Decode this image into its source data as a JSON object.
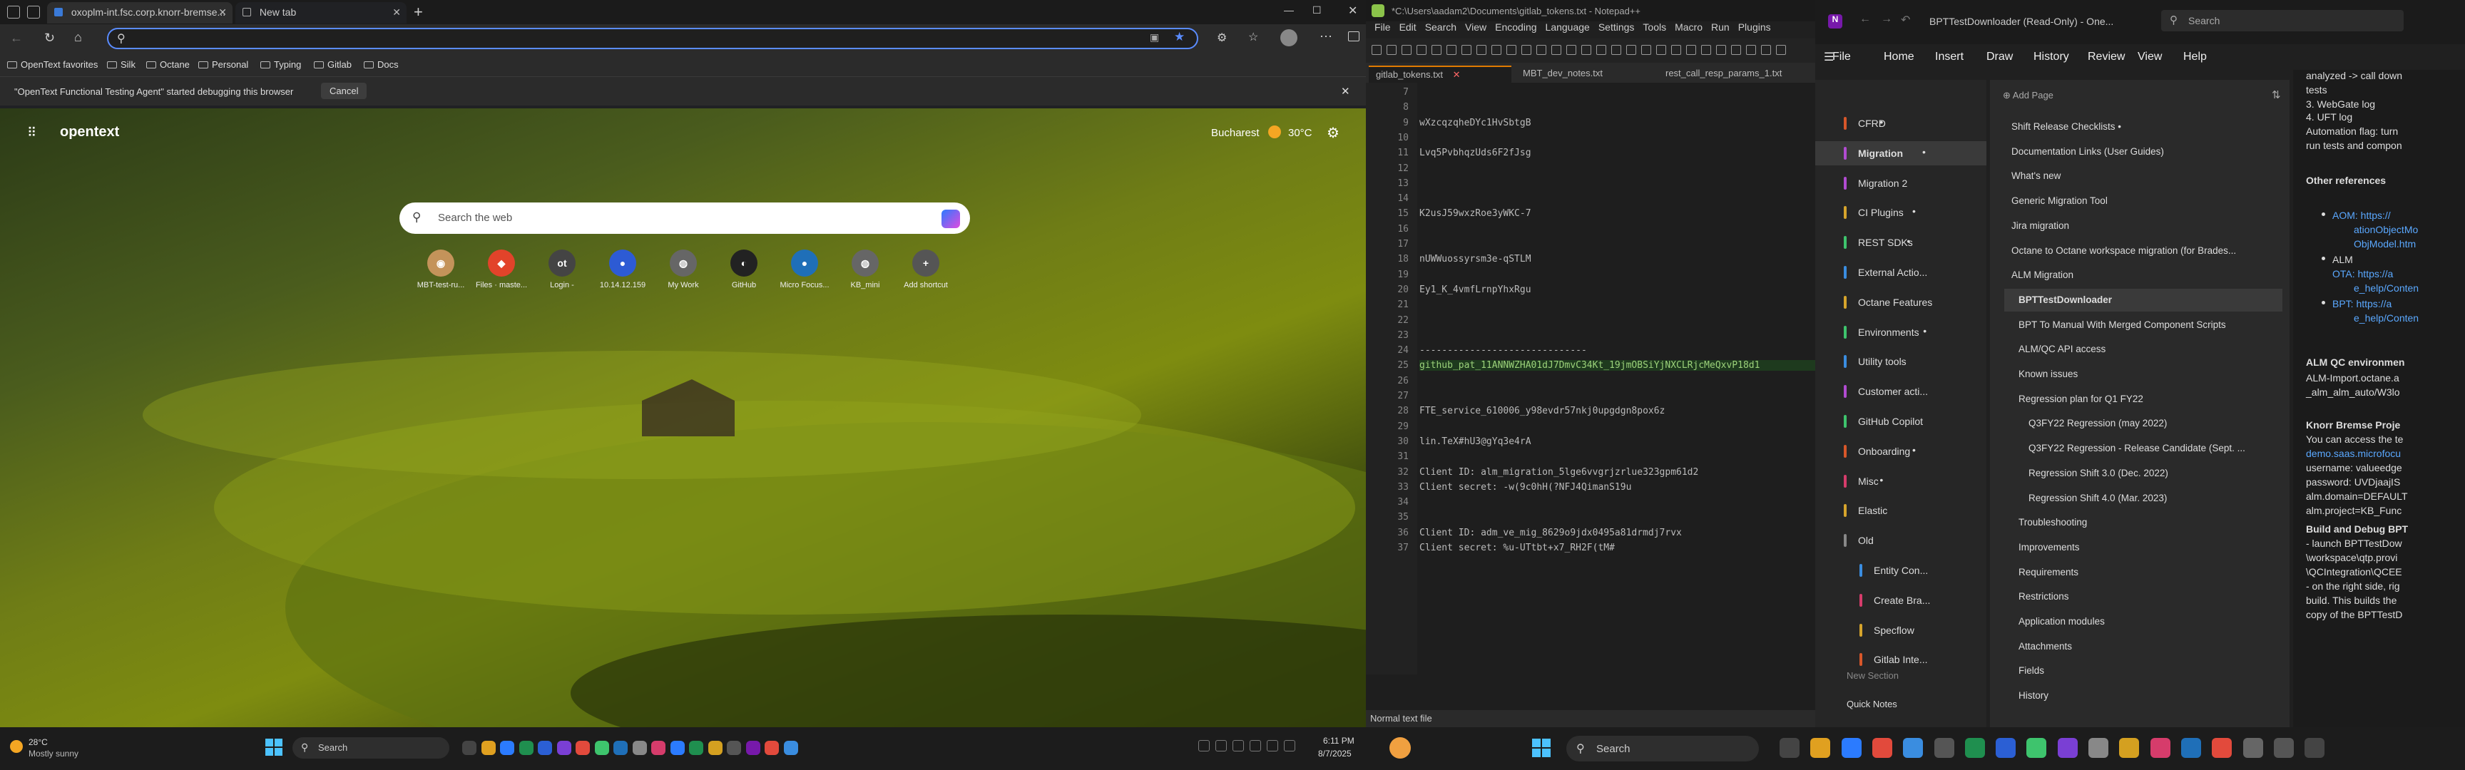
{
  "edge": {
    "tabs": [
      {
        "label": "oxoplm-int.fsc.corp.knorr-bremse..."
      },
      {
        "label": "New tab"
      }
    ],
    "address_value": "",
    "favorites": [
      "OpenText favorites",
      "Silk",
      "Octane",
      "Personal",
      "Typing",
      "Gitlab",
      "Docs"
    ],
    "infobar": {
      "message": "\"OpenText Functional Testing Agent\" started debugging this browser",
      "button": "Cancel"
    },
    "newtab": {
      "brand": "opentext",
      "location": "Bucharest",
      "temperature": "30°C",
      "search_placeholder": "Search the web",
      "shortcuts": [
        {
          "label": "MBT-test-ru...",
          "glyph": "◉",
          "color": "#c4935a"
        },
        {
          "label": "Files · maste...",
          "glyph": "◆",
          "color": "#e2432a"
        },
        {
          "label": "Login -",
          "glyph": "ot",
          "color": "#444"
        },
        {
          "label": "10.14.12.159",
          "glyph": "●",
          "color": "#2d5bd4"
        },
        {
          "label": "My Work",
          "glyph": "◍",
          "color": "#666"
        },
        {
          "label": "GitHub",
          "glyph": "◐",
          "color": "#222"
        },
        {
          "label": "Micro Focus...",
          "glyph": "●",
          "color": "#1f6fb8"
        },
        {
          "label": "KB_mini",
          "glyph": "◍",
          "color": "#666"
        },
        {
          "label": "Add shortcut",
          "glyph": "+",
          "color": "#555"
        }
      ]
    }
  },
  "notepad": {
    "title": "*C:\\Users\\aadam2\\Documents\\gitlab_tokens.txt - Notepad++",
    "menu": [
      "File",
      "Edit",
      "Search",
      "View",
      "Encoding",
      "Language",
      "Settings",
      "Tools",
      "Macro",
      "Run",
      "Plugins"
    ],
    "tabs": [
      "gitlab_tokens.txt",
      "MBT_dev_notes.txt",
      "rest_call_resp_params_1.txt"
    ],
    "lines": [
      {
        "n": "7",
        "t": ""
      },
      {
        "n": "8",
        "t": ""
      },
      {
        "n": "9",
        "t": "wXzcqzqheDYc1HvSbtgB"
      },
      {
        "n": "10",
        "t": ""
      },
      {
        "n": "11",
        "t": "Lvq5PvbhqzUds6F2fJsg"
      },
      {
        "n": "12",
        "t": ""
      },
      {
        "n": "13",
        "t": ""
      },
      {
        "n": "14",
        "t": ""
      },
      {
        "n": "15",
        "t": "K2usJ59wxzRoe3yWKC-7"
      },
      {
        "n": "16",
        "t": ""
      },
      {
        "n": "17",
        "t": ""
      },
      {
        "n": "18",
        "t": "nUWWuossyrsm3e-qSTLM"
      },
      {
        "n": "19",
        "t": ""
      },
      {
        "n": "20",
        "t": "Ey1_K_4vmfLrnpYhxRgu"
      },
      {
        "n": "21",
        "t": ""
      },
      {
        "n": "22",
        "t": ""
      },
      {
        "n": "23",
        "t": ""
      },
      {
        "n": "24",
        "t": "------------------------------"
      },
      {
        "n": "25",
        "t": "github_pat_11ANNWZHA01dJ7DmvC34Kt_19jmOBSiYjNXCLRjcMeQxvP18d1"
      },
      {
        "n": "26",
        "t": ""
      },
      {
        "n": "27",
        "t": ""
      },
      {
        "n": "28",
        "t": "FTE_service_610006_y98evdr57nkj0upgdgn8pox6z"
      },
      {
        "n": "29",
        "t": ""
      },
      {
        "n": "30",
        "t": "lin.TeX#hU3@gYq3e4rA"
      },
      {
        "n": "31",
        "t": ""
      },
      {
        "n": "32",
        "t": "Client ID: alm_migration_5lge6vvgrjzrlue323gpm61d2"
      },
      {
        "n": "33",
        "t": "Client secret: -w(9c0hH(?NFJ4QimanS19u"
      },
      {
        "n": "34",
        "t": ""
      },
      {
        "n": "35",
        "t": ""
      },
      {
        "n": "36",
        "t": "Client ID: adm_ve_mig_8629o9jdx0495a81drmdj7rvx"
      },
      {
        "n": "37",
        "t": "Client secret: %u-UTtbt+x7_RH2F(tM#"
      }
    ],
    "status": "Normal text file"
  },
  "onenote": {
    "doc_title": "BPTTestDownloader (Read-Only) - One...",
    "search_placeholder": "Search",
    "ribbon": [
      "File",
      "Home",
      "Insert",
      "Draw",
      "History",
      "Review",
      "View",
      "Help"
    ],
    "sections": [
      {
        "label": "CFRD",
        "color": "#d8572a",
        "dot": "•"
      },
      {
        "label": "Migration",
        "color": "#b14bd1",
        "dot": "•"
      },
      {
        "label": "Migration 2",
        "color": "#b14bd1",
        "dot": ""
      },
      {
        "label": "CI Plugins",
        "color": "#d6a42c",
        "dot": "•"
      },
      {
        "label": "REST SDKs",
        "color": "#3ec46d",
        "dot": "•"
      },
      {
        "label": "External Actio...",
        "color": "#3a8de0",
        "dot": ""
      },
      {
        "label": "Octane Features",
        "color": "#d6a42c",
        "dot": ""
      },
      {
        "label": "Environments",
        "color": "#3ec46d",
        "dot": "•"
      },
      {
        "label": "Utility tools",
        "color": "#3a8de0",
        "dot": ""
      },
      {
        "label": "Customer acti...",
        "color": "#b14bd1",
        "dot": ""
      },
      {
        "label": "GitHub Copilot",
        "color": "#3ec46d",
        "dot": ""
      },
      {
        "label": "Onboarding",
        "color": "#d8572a",
        "dot": "•"
      },
      {
        "label": "Misc",
        "color": "#d63c6b",
        "dot": "•"
      },
      {
        "label": "Elastic",
        "color": "#d6a42c",
        "dot": ""
      },
      {
        "label": "Old",
        "color": "#888888",
        "dot": ""
      },
      {
        "label": "Entity Con...",
        "color": "#3a8de0",
        "dot": ""
      },
      {
        "label": "Create Bra...",
        "color": "#d63c6b",
        "dot": ""
      },
      {
        "label": "Specflow",
        "color": "#d6a42c",
        "dot": ""
      },
      {
        "label": "Gitlab Inte...",
        "color": "#d8572a",
        "dot": ""
      }
    ],
    "new_section": "New Section",
    "quick_notes": "Quick Notes",
    "add_page": "Add Page",
    "pages": [
      "Shift Release Checklists •",
      "Documentation Links (User Guides)",
      "What's new",
      "Generic Migration Tool",
      "Jira migration",
      "Octane to Octane workspace migration (for Brades...",
      "ALM Migration",
      "BPTTestDownloader",
      "BPT To Manual With Merged Component Scripts",
      "ALM/QC API access",
      "Known issues",
      "Regression plan for Q1 FY22",
      "Q3FY22 Regression (may 2022)",
      "Q3FY22 Regression - Release Candidate (Sept. ...",
      "Regression Shift 3.0 (Dec. 2022)",
      "Regression Shift 4.0 (Mar. 2023)",
      "Troubleshooting",
      "Improvements",
      "Requirements",
      "Restrictions",
      "Application modules",
      "Attachments",
      "Fields",
      "History"
    ],
    "body": [
      "analyzed -> call down",
      "tests",
      "3. WebGate log",
      "4. UFT log",
      "Automation flag: turn",
      "run tests and compon",
      "Other references",
      "AOM:  https://",
      "ationObjectMo",
      "ObjModel.htm",
      "ALM",
      "OTA:  https://a",
      "e_help/Conten",
      "BPT:  https://a",
      "e_help/Conten",
      "ALM QC environmen",
      "ALM-Import.octane.a",
      "_alm_alm_auto/W3lo",
      "Knorr Bremse Proje",
      "You can access the te",
      "demo.saas.microfocu",
      "username: valueedge",
      "password: UVDjaajIS",
      "alm.domain=DEFAULT",
      "alm.project=KB_Func",
      "Build and Debug BPT",
      "- launch BPTTestDow",
      "\\workspace\\qtp.provi",
      "\\QCIntegration\\QCEE",
      "- on the right side, rig",
      "build. This builds the",
      "copy of the BPTTestD"
    ]
  },
  "taskbar": {
    "weather_temp": "28°C",
    "weather_desc": "Mostly sunny",
    "search_label": "Search",
    "search_label_2": "Search",
    "time": "6:11 PM",
    "date": "8/7/2025"
  }
}
